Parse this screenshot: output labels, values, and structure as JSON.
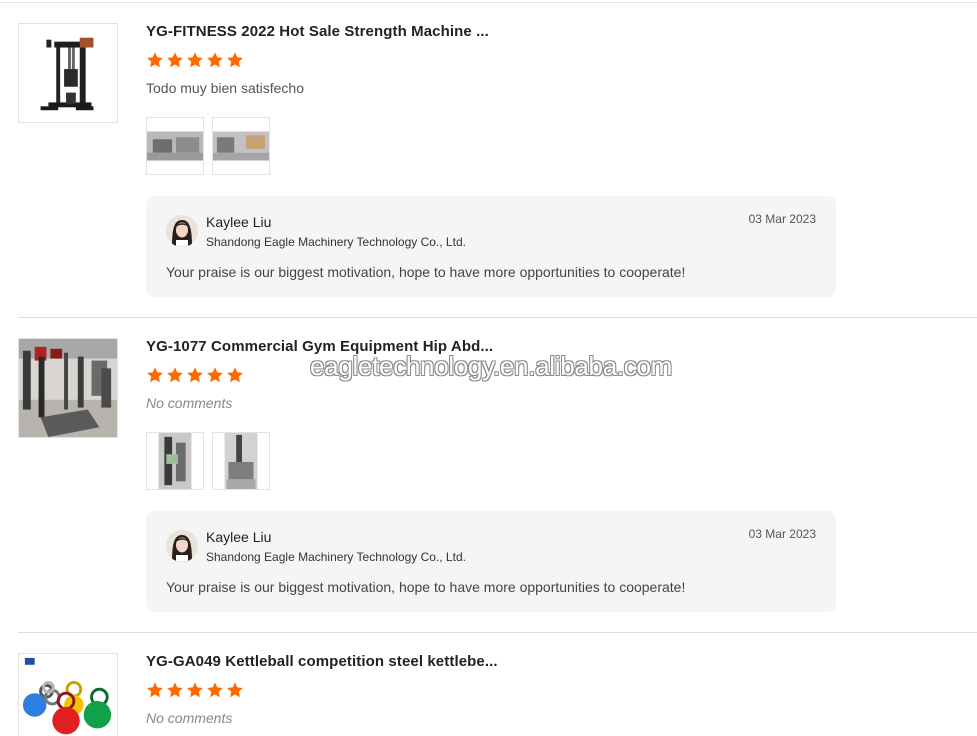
{
  "colors": {
    "star": "#ff6a00",
    "reply_bg": "#f5f5f5",
    "separator": "#dcdcdc"
  },
  "watermark": "eagletechnology.en.alibaba.com",
  "reviews": [
    {
      "title": "YG-FITNESS 2022 Hot Sale Strength Machine ...",
      "rating": 5,
      "comment": "Todo muy bien satisfecho",
      "photo_count": 2,
      "reply": {
        "name": "Kaylee Liu",
        "company": "Shandong Eagle Machinery Technology Co., Ltd.",
        "date": "03 Mar 2023",
        "text": "Your praise is our biggest motivation, hope to have more opportunities to cooperate!"
      }
    },
    {
      "title": "YG-1077 Commercial Gym Equipment Hip Abd...",
      "rating": 5,
      "comment": "No comments",
      "photo_count": 2,
      "reply": {
        "name": "Kaylee Liu",
        "company": "Shandong Eagle Machinery Technology Co., Ltd.",
        "date": "03 Mar 2023",
        "text": "Your praise is our biggest motivation, hope to have more opportunities to cooperate!"
      }
    },
    {
      "title": "YG-GA049 Kettleball competition steel kettlebe...",
      "rating": 5,
      "comment": "No comments"
    }
  ]
}
